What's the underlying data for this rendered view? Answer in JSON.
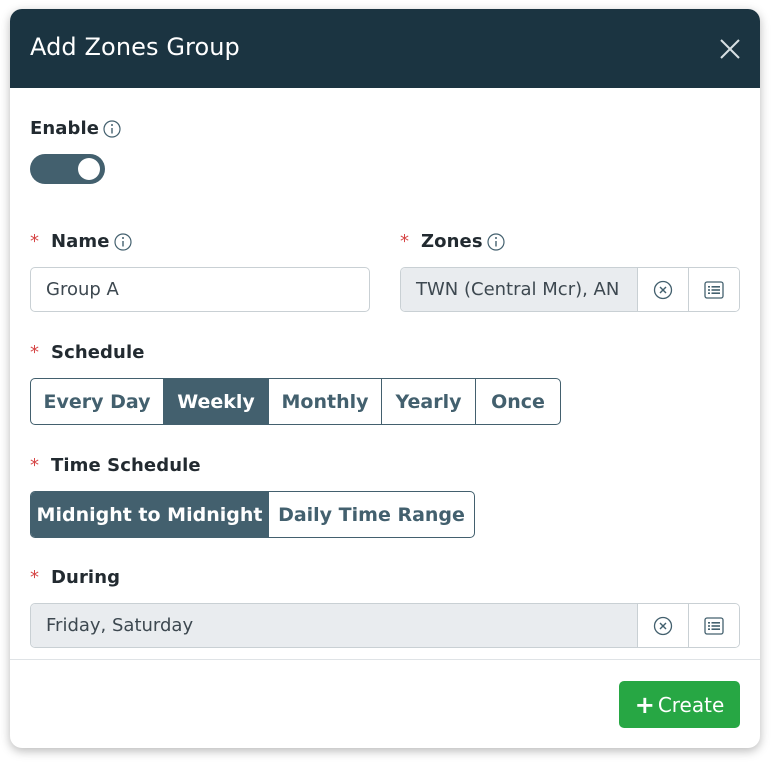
{
  "dialog": {
    "title": "Add Zones Group"
  },
  "enable": {
    "label": "Enable",
    "on": true
  },
  "name": {
    "label": "Name",
    "required_mark": "*",
    "value": "Group A"
  },
  "zones": {
    "label": "Zones",
    "required_mark": "*",
    "value": "TWN (Central Mcr), AN"
  },
  "schedule": {
    "label": "Schedule",
    "required_mark": "*",
    "options": [
      "Every Day",
      "Weekly",
      "Monthly",
      "Yearly",
      "Once"
    ],
    "selected": "Weekly"
  },
  "time_schedule": {
    "label": "Time Schedule",
    "required_mark": "*",
    "options": [
      "Midnight to Midnight",
      "Daily Time Range"
    ],
    "selected": "Midnight to Midnight"
  },
  "during": {
    "label": "During",
    "required_mark": "*",
    "value": "Friday, Saturday"
  },
  "footer": {
    "create_label": "Create"
  },
  "colors": {
    "header_bg": "#1b3441",
    "accent": "#43606e",
    "create_green": "#27a744",
    "required_red": "#d64545"
  },
  "icons": {
    "close": "close-icon",
    "info": "info-icon",
    "clear": "clear-circle-x-icon",
    "list": "list-icon",
    "plus": "plus-icon"
  }
}
